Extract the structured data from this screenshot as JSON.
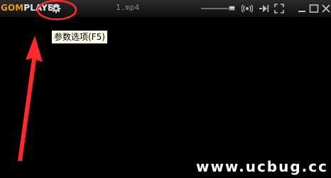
{
  "app": {
    "logo_part1": "GOM",
    "logo_part2": "PLAYER",
    "file_title": "1.mp4"
  },
  "titlebar": {
    "icons": [
      "gear-icon",
      "volume-slider",
      "surround-sound-icon",
      "play-next-icon",
      "fullscreen-icon",
      "minimize-icon",
      "maximize-icon",
      "close-icon"
    ]
  },
  "tooltip": {
    "text": "参数选项(F5)"
  },
  "annotation": {
    "color": "#ff2a2a",
    "watermark": "www.ucbug.cc"
  },
  "colors": {
    "logo_accent": "#f29a1d",
    "background": "#000000",
    "tooltip_bg": "#fffde7"
  }
}
